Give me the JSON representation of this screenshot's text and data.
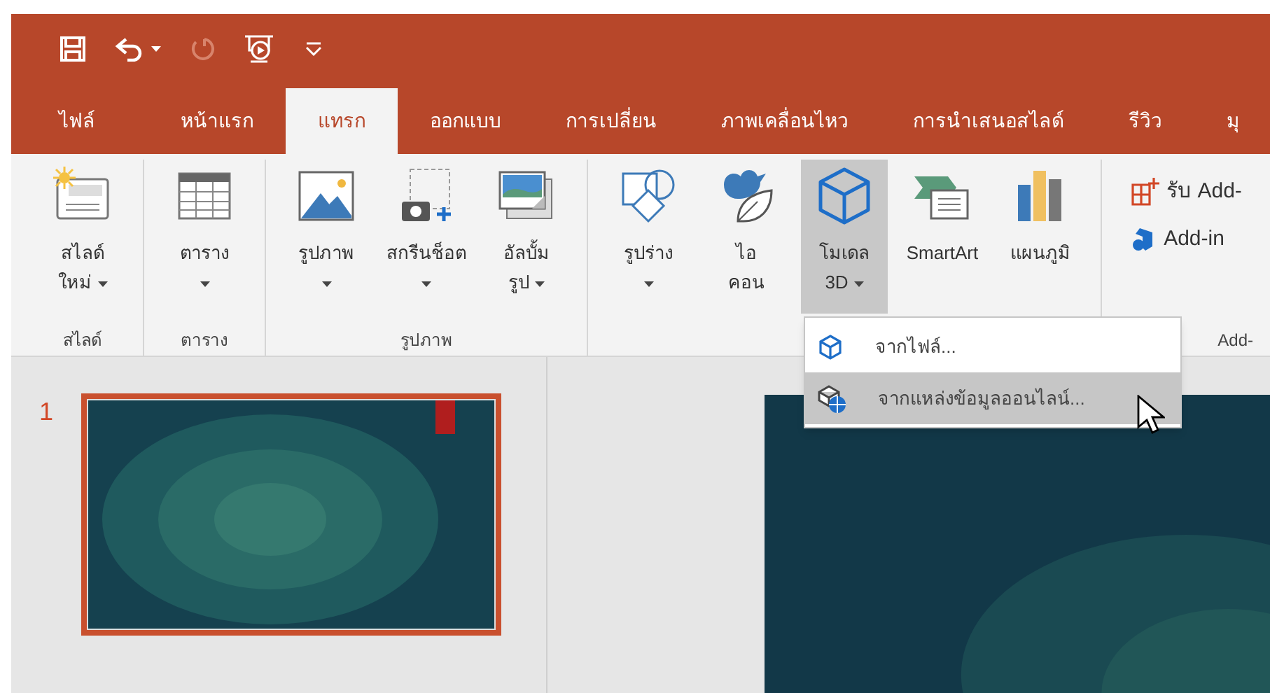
{
  "quick_access": {
    "redo": {
      "disabled": true
    }
  },
  "tabs": [
    {
      "label": "ไฟล์",
      "selected": false
    },
    {
      "label": "หน้าแรก",
      "selected": false
    },
    {
      "label": "แทรก",
      "selected": true
    },
    {
      "label": "ออกแบบ",
      "selected": false
    },
    {
      "label": "การเปลี่ยน",
      "selected": false
    },
    {
      "label": "ภาพเคลื่อนไหว",
      "selected": false
    },
    {
      "label": "การนำเสนอสไลด์",
      "selected": false
    },
    {
      "label": "รีวิว",
      "selected": false
    },
    {
      "label": "มุ",
      "selected": false
    }
  ],
  "ribbon": {
    "groups": [
      {
        "label": "สไลด์",
        "buttons": [
          {
            "kind": "new-slide",
            "lines": [
              "สไลด์",
              "ใหม่"
            ],
            "dropdown": true,
            "selected": false
          }
        ]
      },
      {
        "label": "ตาราง",
        "buttons": [
          {
            "kind": "table",
            "lines": [
              "ตาราง"
            ],
            "dropdown": true,
            "selected": false
          }
        ]
      },
      {
        "label": "รูปภาพ",
        "buttons": [
          {
            "kind": "picture",
            "lines": [
              "รูปภาพ"
            ],
            "dropdown": true,
            "selected": false
          },
          {
            "kind": "screenshot",
            "lines": [
              "สกรีนช็อต"
            ],
            "dropdown": true,
            "selected": false
          },
          {
            "kind": "album",
            "lines": [
              "อัลบั้ม",
              "รูป"
            ],
            "dropdown": true,
            "selected": false
          }
        ]
      },
      {
        "buttons": [
          {
            "kind": "shapes",
            "lines": [
              "รูปร่าง"
            ],
            "dropdown": true,
            "selected": false
          },
          {
            "kind": "icons",
            "lines": [
              "ไอ",
              "คอน"
            ],
            "dropdown": false,
            "selected": false
          },
          {
            "kind": "model3d",
            "lines": [
              "โมเดล",
              "3D"
            ],
            "dropdown": true,
            "selected": true
          },
          {
            "kind": "smartart",
            "lines": [
              "SmartArt"
            ],
            "dropdown": false,
            "selected": false
          },
          {
            "kind": "chart",
            "lines": [
              "แผนภูมิ"
            ],
            "dropdown": false,
            "selected": false
          }
        ]
      },
      {
        "label": "Add-",
        "small_buttons": [
          {
            "kind": "get-addins",
            "label": "รับ Add-"
          },
          {
            "kind": "my-addins",
            "label": "Add-in"
          }
        ]
      }
    ]
  },
  "menu": {
    "items": [
      {
        "kind": "file",
        "label": "จากไฟล์...",
        "selected": false
      },
      {
        "kind": "online",
        "label": "จากแหล่งข้อมูลออนไลน์...",
        "selected": true
      }
    ]
  },
  "slides": [
    {
      "number": "1",
      "selected": true
    }
  ]
}
